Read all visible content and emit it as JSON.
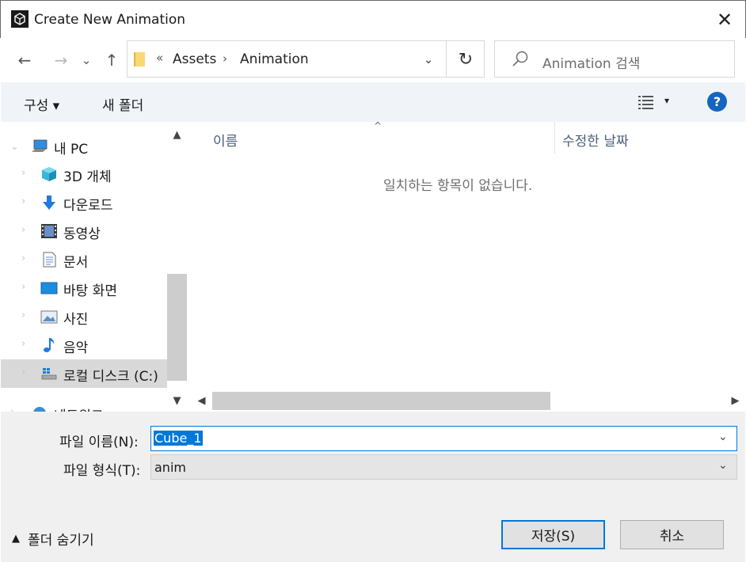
{
  "window": {
    "title": "Create New Animation",
    "close_glyph": "✕"
  },
  "nav": {
    "back_glyph": "←",
    "forward_glyph": "→",
    "recent_glyph": "⌄",
    "up_glyph": "↑"
  },
  "address": {
    "overflow": "«",
    "segments": [
      "Assets",
      "Animation"
    ],
    "separator": "›",
    "dropdown_glyph": "⌄",
    "refresh_glyph": "↻"
  },
  "search": {
    "placeholder": "Animation 검색"
  },
  "toolbar": {
    "organize_label": "구성 ▾",
    "new_folder_label": "새 폴더",
    "view_dropdown_glyph": "▾",
    "help_label": "?"
  },
  "sidebar": {
    "items": [
      {
        "label": "내 PC",
        "icon": "pc-icon"
      },
      {
        "label": "3D 개체",
        "icon": "cube-3d-icon"
      },
      {
        "label": "다운로드",
        "icon": "download-icon"
      },
      {
        "label": "동영상",
        "icon": "video-icon"
      },
      {
        "label": "문서",
        "icon": "document-icon"
      },
      {
        "label": "바탕 화면",
        "icon": "desktop-icon"
      },
      {
        "label": "사진",
        "icon": "pictures-icon"
      },
      {
        "label": "음악",
        "icon": "music-icon"
      },
      {
        "label": "로컬 디스크 (C:)",
        "icon": "drive-icon"
      },
      {
        "label": "네트워크",
        "icon": "network-icon"
      }
    ],
    "scroll_up": "▲",
    "scroll_down": "▼"
  },
  "filelist": {
    "sort_arrow": "^",
    "columns": [
      "이름",
      "수정한 날짜"
    ],
    "empty_message": "일치하는 항목이 없습니다.",
    "scroll_left": "◀",
    "scroll_right": "▶"
  },
  "form": {
    "filename_label": "파일 이름(N):",
    "filename_value": "Cube_1",
    "filetype_label": "파일 형식(T):",
    "filetype_value": "anim",
    "dropdown_glyph": "⌄"
  },
  "footer": {
    "hide_folders_glyph": "▲",
    "hide_folders_label": "폴더 숨기기",
    "save_label": "저장(S)",
    "cancel_label": "취소"
  },
  "colors": {
    "accent": "#0078d7",
    "toolbar_bg": "#f0f4f9",
    "bottom_bg": "#f0f0f0",
    "help": "#1565c0"
  }
}
